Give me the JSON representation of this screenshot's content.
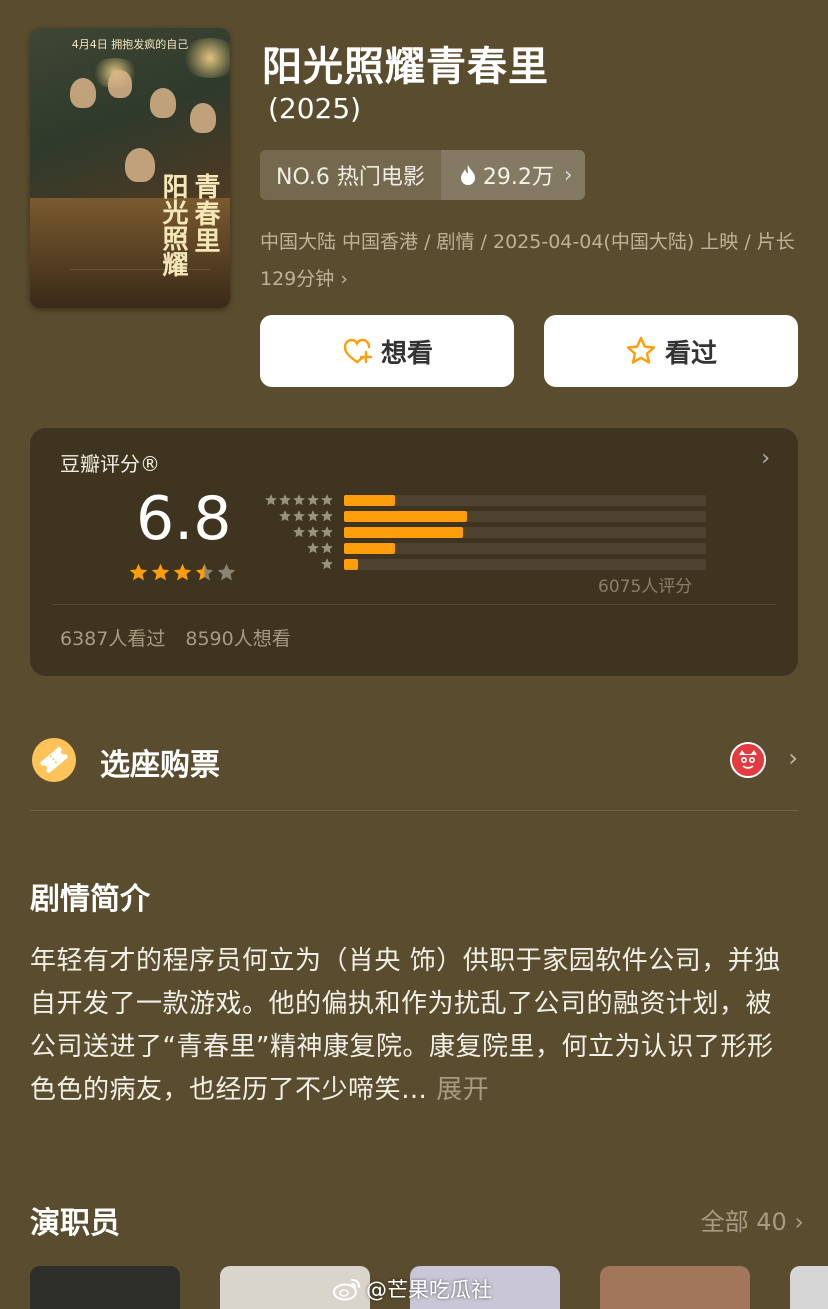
{
  "movie": {
    "title": "阳光照耀青春里",
    "year": "(2025)",
    "rank_label": "NO.6 热门电影",
    "heat_value": "29.2万",
    "meta_line": "中国大陆 中国香港 / 剧情 / 2025-04-04(中国大陆) 上映 / 片长129分钟",
    "poster": {
      "banner": "4月4日  拥抱发疯的自己",
      "title_vertical_right": "青春里",
      "title_vertical_left": "阳光照耀"
    }
  },
  "actions": {
    "want_label": "想看",
    "seen_label": "看过"
  },
  "rating": {
    "label": "豆瓣评分®",
    "score": "6.8",
    "average_stars": 3.5,
    "distribution": [
      {
        "stars": 5,
        "fraction": 0.14
      },
      {
        "stars": 4,
        "fraction": 0.34
      },
      {
        "stars": 3,
        "fraction": 0.33
      },
      {
        "stars": 2,
        "fraction": 0.14
      },
      {
        "stars": 1,
        "fraction": 0.04
      }
    ],
    "count_text": "6075人评分",
    "watched_text": "6387人看过",
    "wish_text": "8590人想看"
  },
  "ticket": {
    "label": "选座购票"
  },
  "synopsis": {
    "title": "剧情简介",
    "text": "年轻有才的程序员何立为（肖央 饰）供职于家园软件公司，并独自开发了一款游戏。他的偏执和作为扰乱了公司的融资计划，被公司送进了“青春里”精神康复院。康复院里，何立为认识了形形色色的病友，也经历了不少啼笑…",
    "expand_label": "展开"
  },
  "cast": {
    "title": "演职员",
    "all_label": "全部 40"
  },
  "watermark": {
    "text": "@芒果吃瓜社"
  },
  "colors": {
    "background": "#5a4c2e",
    "accent_orange": "#ff9d0a",
    "star_orange": "#ff9d0a",
    "muted_text": "#bdb39a"
  },
  "icons": [
    "heart-plus-icon",
    "star-outline-icon",
    "flame-icon",
    "ticket-icon",
    "maoyan-cat-icon",
    "chevron-right-icon",
    "weibo-icon"
  ]
}
